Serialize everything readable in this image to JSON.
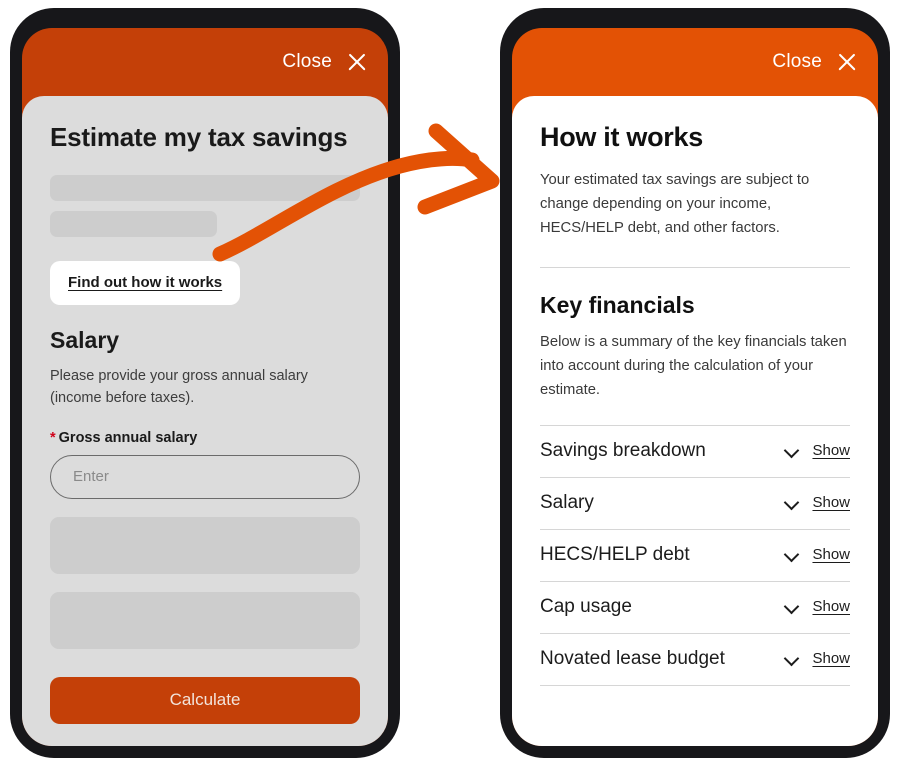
{
  "left_phone": {
    "header": {
      "close_label": "Close",
      "close_icon": "close-x-icon"
    },
    "title": "Estimate my tax savings",
    "link_button": "Find out how it works",
    "section": {
      "heading": "Salary",
      "description": "Please provide your gross annual salary (income before taxes).",
      "required_marker": "*",
      "field_label": "Gross annual salary",
      "field_value": "",
      "field_placeholder": "Enter"
    },
    "submit_label": "Calculate",
    "accent": "#c44008",
    "sheet_bg": "#dcdcdc"
  },
  "right_phone": {
    "header": {
      "close_label": "Close",
      "close_icon": "close-x-icon"
    },
    "title": "How it works",
    "intro": "Your estimated tax savings are subject to change depending on your income, HECS/HELP debt, and other factors.",
    "section_title": "Key financials",
    "section_intro": "Below is a summary of the key financials taken into account during the calculation of your estimate.",
    "accordion": [
      {
        "label": "Savings breakdown",
        "action": "Show",
        "icon": "chevron-down-icon"
      },
      {
        "label": "Salary",
        "action": "Show",
        "icon": "chevron-down-icon"
      },
      {
        "label": "HECS/HELP debt",
        "action": "Show",
        "icon": "chevron-down-icon"
      },
      {
        "label": "Cap usage",
        "action": "Show",
        "icon": "chevron-down-icon"
      },
      {
        "label": "Novated lease budget",
        "action": "Show",
        "icon": "chevron-down-icon"
      }
    ],
    "accent": "#e35205",
    "sheet_bg": "#ffffff"
  },
  "annotation": {
    "arrow_icon": "curved-arrow-icon",
    "arrow_color": "#e35205"
  }
}
